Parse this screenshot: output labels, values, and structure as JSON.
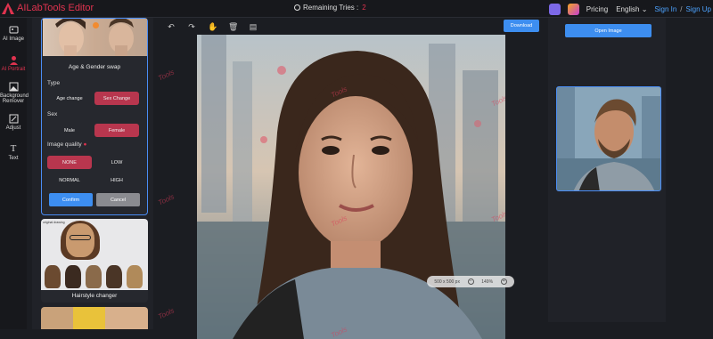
{
  "header": {
    "brand": "AILabTools Editor",
    "remaining_label": "Remaining Tries :",
    "remaining_count": "2",
    "pricing": "Pricing",
    "language": "English",
    "sign_in": "Sign In",
    "separator": "/",
    "sign_up": "Sign Up"
  },
  "nav": [
    {
      "label": "AI Image",
      "icon": "image-sparkle-icon"
    },
    {
      "label": "AI Portrait",
      "icon": "person-icon",
      "active": true
    },
    {
      "label": "Background Remover",
      "icon": "background-icon"
    },
    {
      "label": "Adjust",
      "icon": "adjust-icon"
    },
    {
      "label": "Text",
      "icon": "text-icon"
    }
  ],
  "panel": {
    "card1_title": "Age & Gender swap",
    "type_label": "Type",
    "type_options": [
      "Age change",
      "Sex Change"
    ],
    "type_selected": "Sex Change",
    "sex_label": "Sex",
    "sex_options": [
      "Male",
      "Female"
    ],
    "sex_selected": "Female",
    "quality_label": "Image quality",
    "quality_options": [
      "NONE",
      "LOW",
      "NORMAL",
      "HIGH"
    ],
    "quality_selected": "NONE",
    "confirm": "Confirm",
    "cancel": "Cancel",
    "card2_tag": "original drawing",
    "card2_title": "Hairstyle changer"
  },
  "workspace": {
    "download": "Download",
    "image_size": "500 x 500 px",
    "zoom": "149%",
    "watermark": "Tools"
  },
  "right": {
    "open_image": "Open Image"
  },
  "colors": {
    "accent_red": "#e0334f",
    "accent_blue": "#3d8ef0",
    "selected_option": "#b8364e"
  }
}
